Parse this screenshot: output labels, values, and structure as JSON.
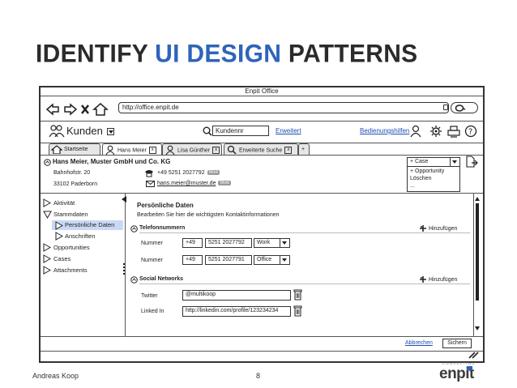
{
  "slide": {
    "title_part1": "IDENTIFY ",
    "title_highlight": "UI DESIGN",
    "title_part2": " PATTERNS",
    "author": "Andreas Koop",
    "page_number": "8",
    "logo_small": "CONSULTING",
    "logo_main": "enpit",
    "accent_color": "#2f64b9"
  },
  "window": {
    "title": "Enpit Office",
    "url": "http://office.enpit.de"
  },
  "toolbar": {
    "module_title": "Kunden",
    "search_value": "Kundennr",
    "advanced_link": "Erweitert",
    "help_link": "Bedienungshilfen"
  },
  "tabs": [
    {
      "label": "Startseite"
    },
    {
      "label": "Hans Meier"
    },
    {
      "label": "Lisa Günther"
    },
    {
      "label": "Erweiterte Suche"
    }
  ],
  "tab_plus": "+",
  "customer": {
    "name": "Hans Meier, Muster GmbH und Co. KG",
    "street": "Bahnhofstr. 20",
    "city": "33102 Paderborn",
    "phone": "+49 5251 2027792",
    "phone_badge": "Work",
    "email": "hans.meier@muster.de",
    "email_badge": "Work"
  },
  "case_menu": {
    "selected": "+ Case",
    "options": [
      "+ Opportunity",
      "Löschen",
      "..."
    ]
  },
  "nav": {
    "items": [
      {
        "label": "Aktivität"
      },
      {
        "label": "Stammdaten"
      },
      {
        "label": "Persönliche Daten"
      },
      {
        "label": "Anschriften"
      },
      {
        "label": "Opportunities"
      },
      {
        "label": "Cases"
      },
      {
        "label": "Attachments"
      }
    ]
  },
  "content": {
    "heading": "Persönliche Daten",
    "subheading": "Bearbeiten Sie hier die wichtigsten Kontaktinformationen",
    "phone_section": "Telefonnummern",
    "add_label": "Hinzufügen",
    "phone_rows": [
      {
        "label": "Nummer",
        "prefix": "+49",
        "number": "5251 2027792",
        "type": "Work"
      },
      {
        "label": "Nummer",
        "prefix": "+49",
        "number": "5251 2027791",
        "type": "Office"
      }
    ],
    "social_section": "Social Networks",
    "social_rows": [
      {
        "label": "Twitter",
        "value": "@multikoop"
      },
      {
        "label": "Linked In",
        "value": "http://linkedin.com/profile/123234234"
      }
    ],
    "cancel_link": "Abbrechen",
    "save_button": "Sichern"
  }
}
